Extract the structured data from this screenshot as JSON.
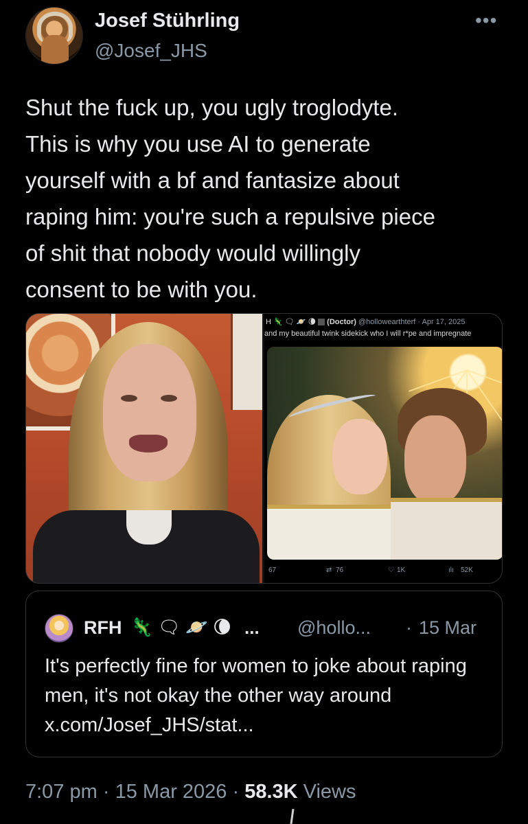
{
  "tweet": {
    "author": {
      "display_name": "Josef Stührling",
      "handle": "@Josef_JHS",
      "avatar": "author-avatar"
    },
    "more_icon": "•••",
    "text": "Shut the fuck up, you ugly troglodyte.\nThis is why you use AI to generate\nyourself with a bf and fantasize about\nraping him: you're such a repulsive piece\nof shit that nobody would willingly\nconsent to be with you.",
    "meta": {
      "time": "7:07 pm",
      "date": "15 Mar 2026",
      "separator": "·",
      "views_count": "58.3K",
      "views_label": "Views"
    }
  },
  "media": {
    "embedded_post": {
      "header_line1_prefix": "H",
      "header_line1_name": "(Doctor)",
      "header_line1_handle_date": "@hollowearthterf · Apr 17, 2025",
      "header_line2": "and my beautiful twink sidekick who I will r*pe and impregnate",
      "stats": {
        "replies": "67",
        "retweets": "76",
        "likes": "1K",
        "views": "52K"
      },
      "stat_icons": {
        "retweets": "⇄",
        "likes": "♡",
        "views": "ılı"
      }
    }
  },
  "quote": {
    "name": "RFH",
    "emojis": [
      "🦎",
      "🗨",
      "🪐",
      "🌘"
    ],
    "ellipsis": "...",
    "handle": "@hollo...",
    "separator": "·",
    "date": "15 Mar",
    "text": "It's perfectly fine for women to joke about raping men, it's not okay the other way around x.com/Josef_JHS/stat..."
  }
}
